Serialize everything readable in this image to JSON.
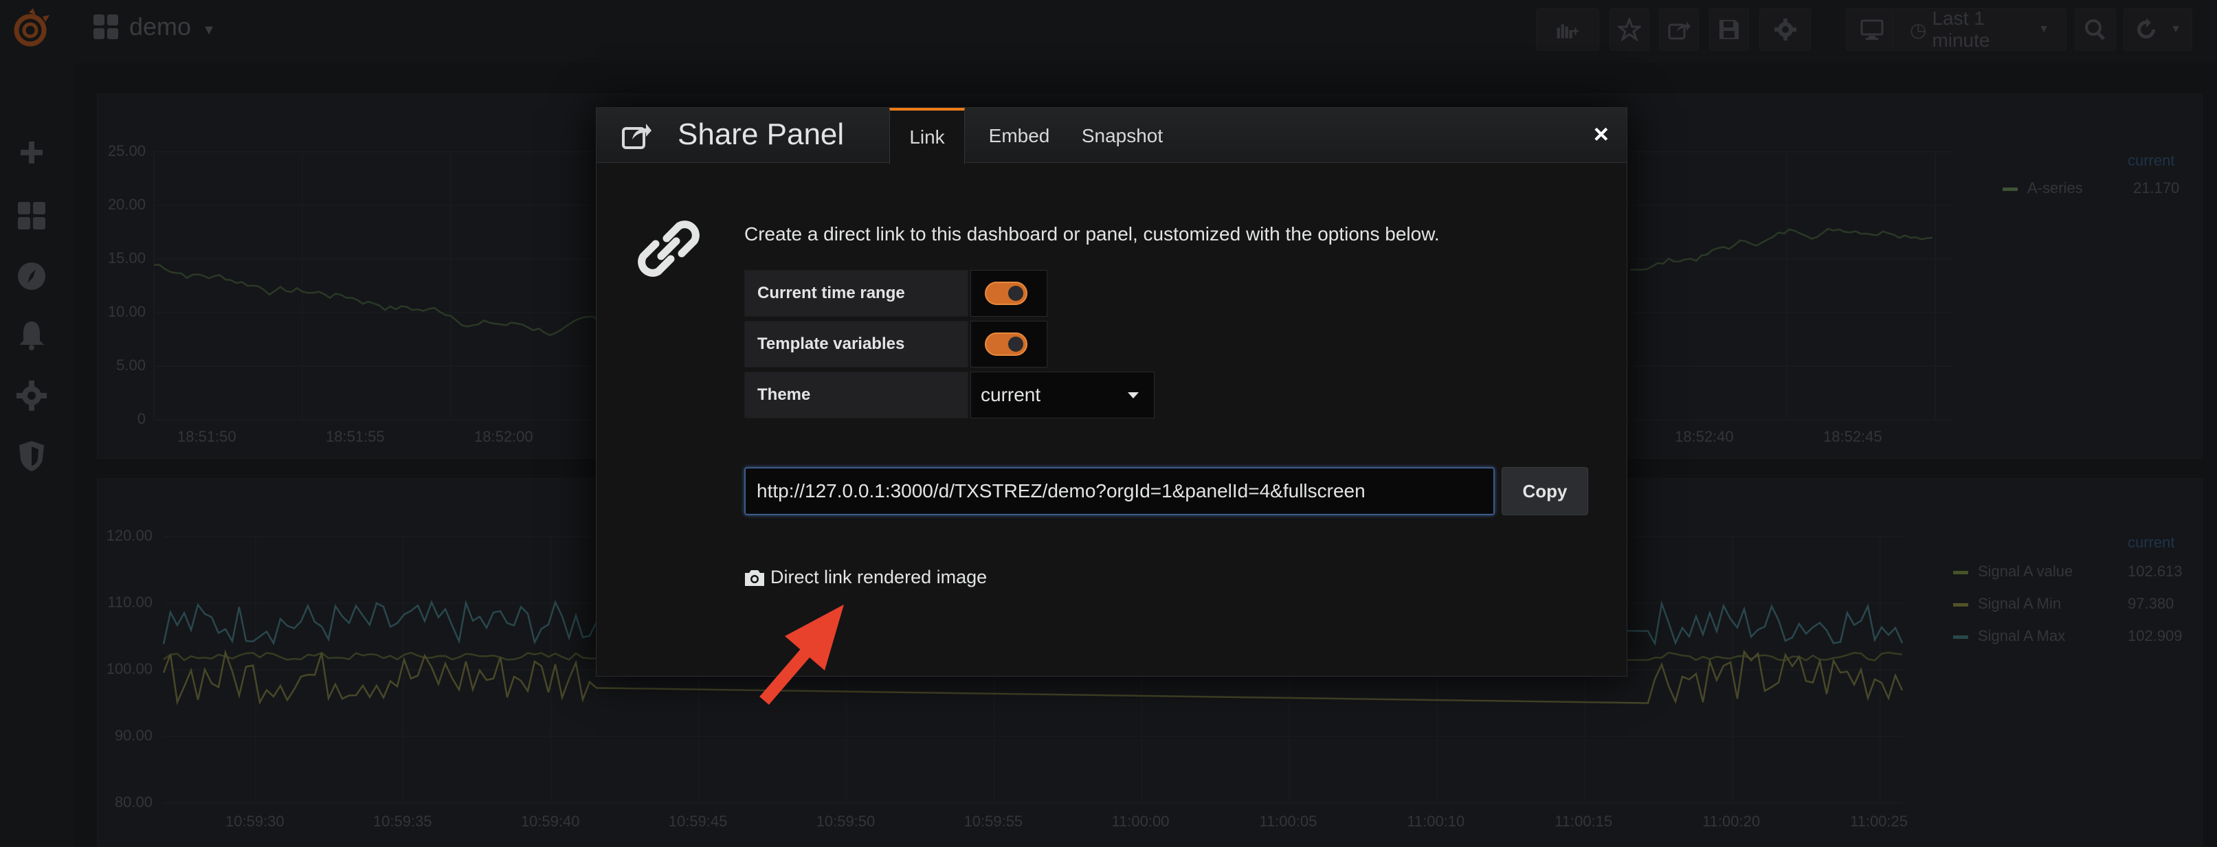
{
  "navbar": {
    "dashboard_title": "demo",
    "time_range": "Last 1 minute"
  },
  "sidemenu": {
    "items": [
      "plus-icon",
      "dashboards-icon",
      "explore-icon",
      "alerting-icon",
      "configuration-icon",
      "server-admin-icon"
    ]
  },
  "panels": {
    "top": {
      "y_ticks": [
        "25.00",
        "20.00",
        "15.00",
        "10.00",
        "5.00",
        "0"
      ],
      "x_ticks_left": [
        "18:51:50",
        "18:51:55",
        "18:52:00"
      ],
      "x_ticks_right": [
        "18:52:40",
        "18:52:45"
      ],
      "legend_header": "current",
      "legend": [
        {
          "name": "A-series",
          "value": "21.170",
          "color": "#5a7a4a"
        }
      ]
    },
    "bottom": {
      "y_ticks": [
        "120.00",
        "110.00",
        "100.00",
        "90.00",
        "80.00"
      ],
      "x_ticks": [
        "10:59:30",
        "10:59:35",
        "10:59:40",
        "10:59:45",
        "10:59:50",
        "10:59:55",
        "11:00:00",
        "11:00:05",
        "11:00:10",
        "11:00:15",
        "11:00:20",
        "11:00:25"
      ],
      "legend_header": "current",
      "legend": [
        {
          "name": "Signal A value",
          "value": "102.613",
          "color": "#6a7a3a"
        },
        {
          "name": "Signal A Min",
          "value": "97.380",
          "color": "#7a7a3a"
        },
        {
          "name": "Signal A Max",
          "value": "102.909",
          "color": "#3a6a6a"
        }
      ]
    }
  },
  "modal": {
    "title": "Share Panel",
    "tabs": [
      "Link",
      "Embed",
      "Snapshot"
    ],
    "active_tab": "Link",
    "close_label": "×",
    "intro": "Create a direct link to this dashboard or panel, customized with the options below.",
    "options": {
      "current_time_range": {
        "label": "Current time range",
        "enabled": true
      },
      "template_variables": {
        "label": "Template variables",
        "enabled": true
      },
      "theme": {
        "label": "Theme",
        "value": "current"
      }
    },
    "url": "http://127.0.0.1:3000/d/TXSTREZ/demo?orgId=1&panelId=4&fullscreen",
    "copy_label": "Copy",
    "render_link_label": "Direct link rendered image"
  },
  "colors": {
    "accent": "#eb7b18",
    "annotation_arrow": "#e8412c"
  }
}
